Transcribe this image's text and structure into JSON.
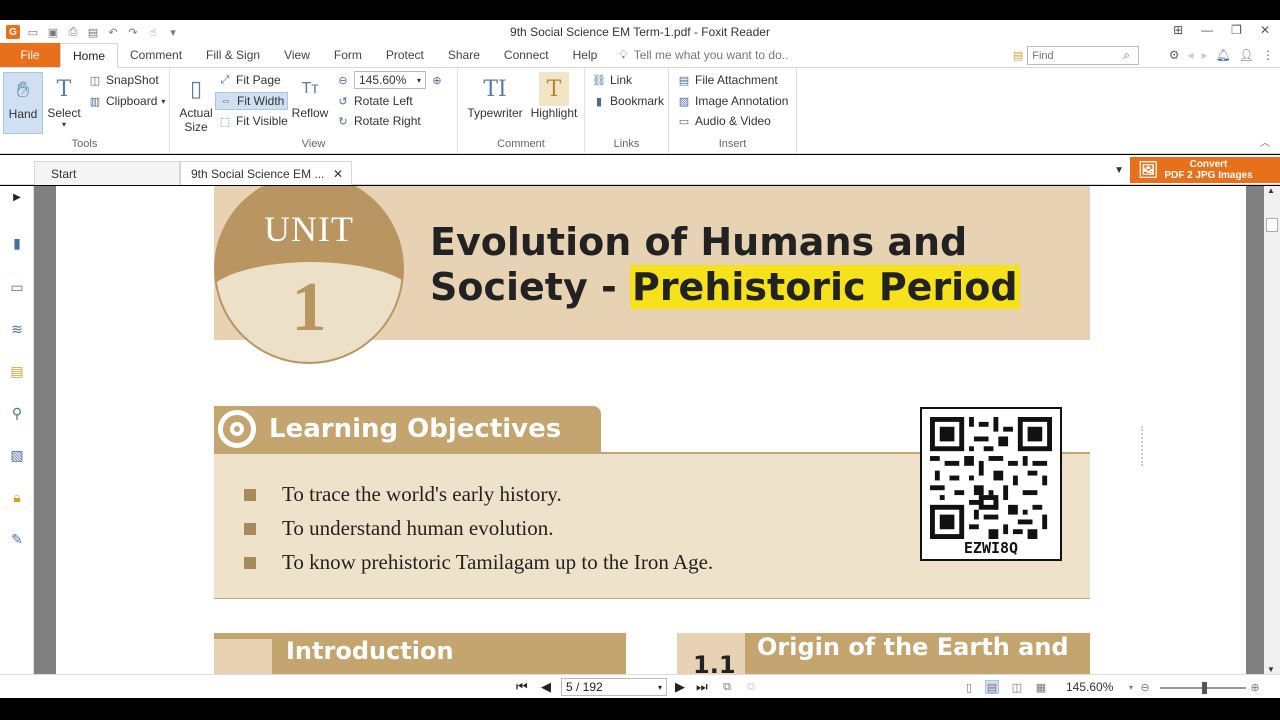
{
  "window": {
    "title": "9th Social Science EM Term-1.pdf - Foxit Reader"
  },
  "menu": {
    "file": "File",
    "tabs": [
      "Home",
      "Comment",
      "Fill & Sign",
      "View",
      "Form",
      "Protect",
      "Share",
      "Connect",
      "Help"
    ],
    "tell_me": "Tell me what you want to do..",
    "find_placeholder": "Find"
  },
  "ribbon": {
    "tools": {
      "label": "Tools",
      "hand": "Hand",
      "select": "Select",
      "snapshot": "SnapShot",
      "clipboard": "Clipboard"
    },
    "view": {
      "label": "View",
      "actual_size_line1": "Actual",
      "actual_size_line2": "Size",
      "fit_page": "Fit Page",
      "fit_width": "Fit Width",
      "fit_visible": "Fit Visible",
      "reflow": "Reflow",
      "zoom": "145.60%",
      "rotate_left": "Rotate Left",
      "rotate_right": "Rotate Right"
    },
    "comment": {
      "label": "Comment",
      "typewriter": "Typewriter",
      "highlight": "Highlight"
    },
    "links": {
      "label": "Links",
      "link": "Link",
      "bookmark": "Bookmark"
    },
    "insert": {
      "label": "Insert",
      "file_attachment": "File Attachment",
      "image_annotation": "Image Annotation",
      "audio_video": "Audio & Video"
    }
  },
  "doc_tabs": {
    "start": "Start",
    "current": "9th Social Science EM ...",
    "convert_line1": "Convert",
    "convert_line2": "PDF 2 JPG Images"
  },
  "page": {
    "unit_word": "UNIT",
    "unit_number": "1",
    "title_line1": "Evolution of Humans and",
    "title_line2_plain": "Society - ",
    "title_line2_highlight": "Prehistoric Period",
    "learning_objectives_title": "Learning Objectives",
    "objectives": [
      "To trace the world's early history.",
      "To understand human evolution.",
      "To know prehistoric Tamilagam up to the Iron Age."
    ],
    "qr_code_text": "EZWI8Q",
    "introduction_title": "Introduction",
    "section_number": "1.1",
    "section_title": "Origin of the Earth and"
  },
  "status": {
    "page": "5 / 192",
    "zoom": "145.60%"
  },
  "colors": {
    "accent_orange": "#e8701a",
    "banner_tan": "#e7d3b4",
    "header_brown": "#c4a46f",
    "highlight_yellow": "#f5e21a"
  }
}
